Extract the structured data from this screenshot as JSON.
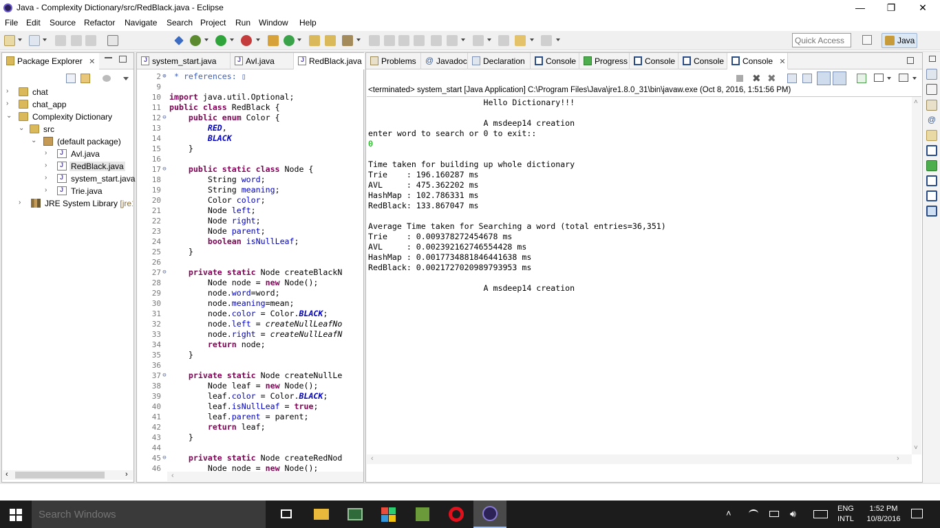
{
  "window": {
    "title": "Java - Complexity Dictionary/src/RedBlack.java - Eclipse",
    "minimize": "—",
    "restore": "❐",
    "close": "✕"
  },
  "menu": [
    "File",
    "Edit",
    "Source",
    "Refactor",
    "Navigate",
    "Search",
    "Project",
    "Run",
    "Window",
    "Help"
  ],
  "toolbar": {
    "quick_access_placeholder": "Quick Access",
    "perspective": "Java"
  },
  "package_explorer": {
    "tab_label": "Package Explorer",
    "close": "✕",
    "items": [
      {
        "label": "chat",
        "arrow": "›"
      },
      {
        "label": "chat_app",
        "arrow": "›"
      },
      {
        "label": "Complexity Dictionary",
        "arrow": "⌄"
      },
      {
        "label": "src",
        "arrow": "⌄"
      },
      {
        "label": "(default package)",
        "arrow": "⌄"
      },
      {
        "label": "Avl.java",
        "arrow": "›"
      },
      {
        "label": "RedBlack.java",
        "arrow": "›"
      },
      {
        "label": "system_start.java",
        "arrow": "›"
      },
      {
        "label": "Trie.java",
        "arrow": "›"
      },
      {
        "label": "JRE System Library",
        "suffix": "[jre1.",
        "arrow": "›"
      }
    ]
  },
  "editor": {
    "tabs": [
      "system_start.java",
      "Avl.java",
      "RedBlack.java"
    ],
    "active_tab": "RedBlack.java",
    "lines": [
      {
        "n": "2",
        "fold": "⊕",
        "segs": [
          [
            "cmt",
            " * references: ▯"
          ]
        ]
      },
      {
        "n": "9",
        "fold": "",
        "segs": []
      },
      {
        "n": "10",
        "fold": "",
        "segs": [
          [
            "kw",
            "import"
          ],
          [
            "",
            " java.util.Optional;"
          ]
        ]
      },
      {
        "n": "11",
        "fold": "",
        "segs": [
          [
            "kw",
            "public class"
          ],
          [
            "",
            " RedBlack {"
          ]
        ]
      },
      {
        "n": "12",
        "fold": "⊖",
        "segs": [
          [
            "",
            "    "
          ],
          [
            "kw",
            "public enum"
          ],
          [
            "",
            " Color {"
          ]
        ]
      },
      {
        "n": "13",
        "fold": "",
        "segs": [
          [
            "",
            "        "
          ],
          [
            "sfld",
            "RED"
          ],
          [
            "",
            ","
          ]
        ]
      },
      {
        "n": "14",
        "fold": "",
        "segs": [
          [
            "",
            "        "
          ],
          [
            "sfld",
            "BLACK"
          ]
        ]
      },
      {
        "n": "15",
        "fold": "",
        "segs": [
          [
            "",
            "    }"
          ]
        ]
      },
      {
        "n": "16",
        "fold": "",
        "segs": []
      },
      {
        "n": "17",
        "fold": "⊖",
        "segs": [
          [
            "",
            "    "
          ],
          [
            "kw",
            "public static class"
          ],
          [
            "",
            " Node {"
          ]
        ]
      },
      {
        "n": "18",
        "fold": "",
        "segs": [
          [
            "",
            "        String "
          ],
          [
            "fld",
            "word"
          ],
          [
            "",
            ";"
          ]
        ]
      },
      {
        "n": "19",
        "fold": "",
        "segs": [
          [
            "",
            "        String "
          ],
          [
            "fld",
            "meaning"
          ],
          [
            "",
            ";"
          ]
        ]
      },
      {
        "n": "20",
        "fold": "",
        "segs": [
          [
            "",
            "        Color "
          ],
          [
            "fld",
            "color"
          ],
          [
            "",
            ";"
          ]
        ]
      },
      {
        "n": "21",
        "fold": "",
        "segs": [
          [
            "",
            "        Node "
          ],
          [
            "fld",
            "left"
          ],
          [
            "",
            ";"
          ]
        ]
      },
      {
        "n": "22",
        "fold": "",
        "segs": [
          [
            "",
            "        Node "
          ],
          [
            "fld",
            "right"
          ],
          [
            "",
            ";"
          ]
        ]
      },
      {
        "n": "23",
        "fold": "",
        "segs": [
          [
            "",
            "        Node "
          ],
          [
            "fld",
            "parent"
          ],
          [
            "",
            ";"
          ]
        ]
      },
      {
        "n": "24",
        "fold": "",
        "segs": [
          [
            "",
            "        "
          ],
          [
            "kw",
            "boolean"
          ],
          [
            "",
            " "
          ],
          [
            "fld",
            "isNullLeaf"
          ],
          [
            "",
            ";"
          ]
        ]
      },
      {
        "n": "25",
        "fold": "",
        "segs": [
          [
            "",
            "    }"
          ]
        ]
      },
      {
        "n": "26",
        "fold": "",
        "segs": []
      },
      {
        "n": "27",
        "fold": "⊖",
        "segs": [
          [
            "",
            "    "
          ],
          [
            "kw",
            "private static"
          ],
          [
            "",
            " Node createBlackN"
          ]
        ]
      },
      {
        "n": "28",
        "fold": "",
        "segs": [
          [
            "",
            "        Node node = "
          ],
          [
            "kw",
            "new"
          ],
          [
            "",
            " Node();"
          ]
        ]
      },
      {
        "n": "29",
        "fold": "",
        "segs": [
          [
            "",
            "        node."
          ],
          [
            "fld",
            "word"
          ],
          [
            "",
            "=word;"
          ]
        ]
      },
      {
        "n": "30",
        "fold": "",
        "segs": [
          [
            "",
            "        node."
          ],
          [
            "fld",
            "meaning"
          ],
          [
            "",
            "=mean;"
          ]
        ]
      },
      {
        "n": "31",
        "fold": "",
        "segs": [
          [
            "",
            "        node."
          ],
          [
            "fld",
            "color"
          ],
          [
            "",
            " = Color."
          ],
          [
            "sfld",
            "BLACK"
          ],
          [
            "",
            ";"
          ]
        ]
      },
      {
        "n": "32",
        "fold": "",
        "segs": [
          [
            "",
            "        node."
          ],
          [
            "fld",
            "left"
          ],
          [
            "",
            " = "
          ],
          [
            "ital",
            "createNullLeafNo"
          ]
        ]
      },
      {
        "n": "33",
        "fold": "",
        "segs": [
          [
            "",
            "        node."
          ],
          [
            "fld",
            "right"
          ],
          [
            "",
            " = "
          ],
          [
            "ital",
            "createNullLeafN"
          ]
        ]
      },
      {
        "n": "34",
        "fold": "",
        "segs": [
          [
            "",
            "        "
          ],
          [
            "kw",
            "return"
          ],
          [
            "",
            " node;"
          ]
        ]
      },
      {
        "n": "35",
        "fold": "",
        "segs": [
          [
            "",
            "    }"
          ]
        ]
      },
      {
        "n": "36",
        "fold": "",
        "segs": []
      },
      {
        "n": "37",
        "fold": "⊖",
        "segs": [
          [
            "",
            "    "
          ],
          [
            "kw",
            "private static"
          ],
          [
            "",
            " Node createNullLe"
          ]
        ]
      },
      {
        "n": "38",
        "fold": "",
        "segs": [
          [
            "",
            "        Node leaf = "
          ],
          [
            "kw",
            "new"
          ],
          [
            "",
            " Node();"
          ]
        ]
      },
      {
        "n": "39",
        "fold": "",
        "segs": [
          [
            "",
            "        leaf."
          ],
          [
            "fld",
            "color"
          ],
          [
            "",
            " = Color."
          ],
          [
            "sfld",
            "BLACK"
          ],
          [
            "",
            ";"
          ]
        ]
      },
      {
        "n": "40",
        "fold": "",
        "segs": [
          [
            "",
            "        leaf."
          ],
          [
            "fld",
            "isNullLeaf"
          ],
          [
            "",
            " = "
          ],
          [
            "kw",
            "true"
          ],
          [
            "",
            ";"
          ]
        ]
      },
      {
        "n": "41",
        "fold": "",
        "segs": [
          [
            "",
            "        leaf."
          ],
          [
            "fld",
            "parent"
          ],
          [
            "",
            " = parent;"
          ]
        ]
      },
      {
        "n": "42",
        "fold": "",
        "segs": [
          [
            "",
            "        "
          ],
          [
            "kw",
            "return"
          ],
          [
            "",
            " leaf;"
          ]
        ]
      },
      {
        "n": "43",
        "fold": "",
        "segs": [
          [
            "",
            "    }"
          ]
        ]
      },
      {
        "n": "44",
        "fold": "",
        "segs": []
      },
      {
        "n": "45",
        "fold": "⊖",
        "segs": [
          [
            "",
            "    "
          ],
          [
            "kw",
            "private static"
          ],
          [
            "",
            " Node createRedNod"
          ]
        ]
      },
      {
        "n": "46",
        "fold": "",
        "segs": [
          [
            "",
            "        Node node = "
          ],
          [
            "kw",
            "new"
          ],
          [
            "",
            " Node();"
          ]
        ]
      }
    ]
  },
  "console_view": {
    "tabs": [
      "Problems",
      "Javadoc",
      "Declaration",
      "Console",
      "Progress",
      "Console",
      "Console",
      "Console"
    ],
    "active_tab": "Console",
    "close": "✕",
    "status": "<terminated> system_start [Java Application] C:\\Program Files\\Java\\jre1.8.0_31\\bin\\javaw.exe (Oct 8, 2016, 1:51:56 PM)",
    "output": [
      {
        "t": "                        Hello Dictionary!!!",
        "k": "out"
      },
      {
        "t": "",
        "k": "out"
      },
      {
        "t": "                        A msdeep14 creation",
        "k": "out"
      },
      {
        "t": "enter word to search or 0 to exit::",
        "k": "out"
      },
      {
        "t": "0",
        "k": "in"
      },
      {
        "t": "",
        "k": "out"
      },
      {
        "t": "Time taken for building up whole dictionary",
        "k": "out"
      },
      {
        "t": "Trie    : 196.160287 ms",
        "k": "out"
      },
      {
        "t": "AVL     : 475.362202 ms",
        "k": "out"
      },
      {
        "t": "HashMap : 102.786331 ms",
        "k": "out"
      },
      {
        "t": "RedBlack: 133.867047 ms",
        "k": "out"
      },
      {
        "t": "",
        "k": "out"
      },
      {
        "t": "Average Time taken for Searching a word (total entries=36,351)",
        "k": "out"
      },
      {
        "t": "Trie    : 0.009378272454678 ms",
        "k": "out"
      },
      {
        "t": "AVL     : 0.002392162746554428 ms",
        "k": "out"
      },
      {
        "t": "HashMap : 0.0017734881846441638 ms",
        "k": "out"
      },
      {
        "t": "RedBlack: 0.0021727020989793953 ms",
        "k": "out"
      },
      {
        "t": "",
        "k": "out"
      },
      {
        "t": "                        A msdeep14 creation",
        "k": "out"
      }
    ]
  },
  "taskbar": {
    "search_placeholder": "Search Windows",
    "lang_line1": "ENG",
    "lang_line2": "INTL",
    "time": "1:52 PM",
    "date": "10/8/2016"
  }
}
